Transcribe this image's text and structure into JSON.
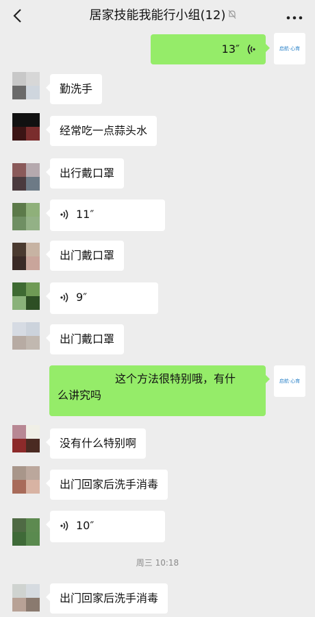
{
  "header": {
    "title": "居家技能我能行小组(12)",
    "back_icon": "chevron-left-icon",
    "mute_icon": "bell-off-icon",
    "more_icon": "more-dots-icon"
  },
  "messages": [
    {
      "side": "right",
      "type": "voice",
      "duration": "13″"
    },
    {
      "side": "left",
      "type": "text",
      "text": "勤洗手"
    },
    {
      "side": "left",
      "type": "text",
      "text": "经常吃一点蒜头水"
    },
    {
      "side": "left",
      "type": "text",
      "text": "出行戴口罩"
    },
    {
      "side": "left",
      "type": "voice",
      "duration": "11″"
    },
    {
      "side": "left",
      "type": "text",
      "text": "出门戴口罩"
    },
    {
      "side": "left",
      "type": "voice",
      "duration": "9″"
    },
    {
      "side": "left",
      "type": "text",
      "text": "出门戴口罩"
    },
    {
      "side": "right",
      "type": "text",
      "text_line1": "这个方法很特别哦，有什",
      "text_line2": "么讲究吗"
    },
    {
      "side": "left",
      "type": "text",
      "text": "没有什么特别啊"
    },
    {
      "side": "left",
      "type": "text",
      "text": "出门回家后洗手消毒"
    },
    {
      "side": "left",
      "type": "voice",
      "duration": "10″"
    },
    {
      "side": "left",
      "type": "text",
      "text": "出门回家后洗手消毒"
    }
  ],
  "time_separator": "周三 10:18",
  "self_avatar_logo_text": "启航·心育",
  "colors": {
    "background": "#ededed",
    "bubble_self": "#95ec69",
    "bubble_other": "#ffffff"
  }
}
